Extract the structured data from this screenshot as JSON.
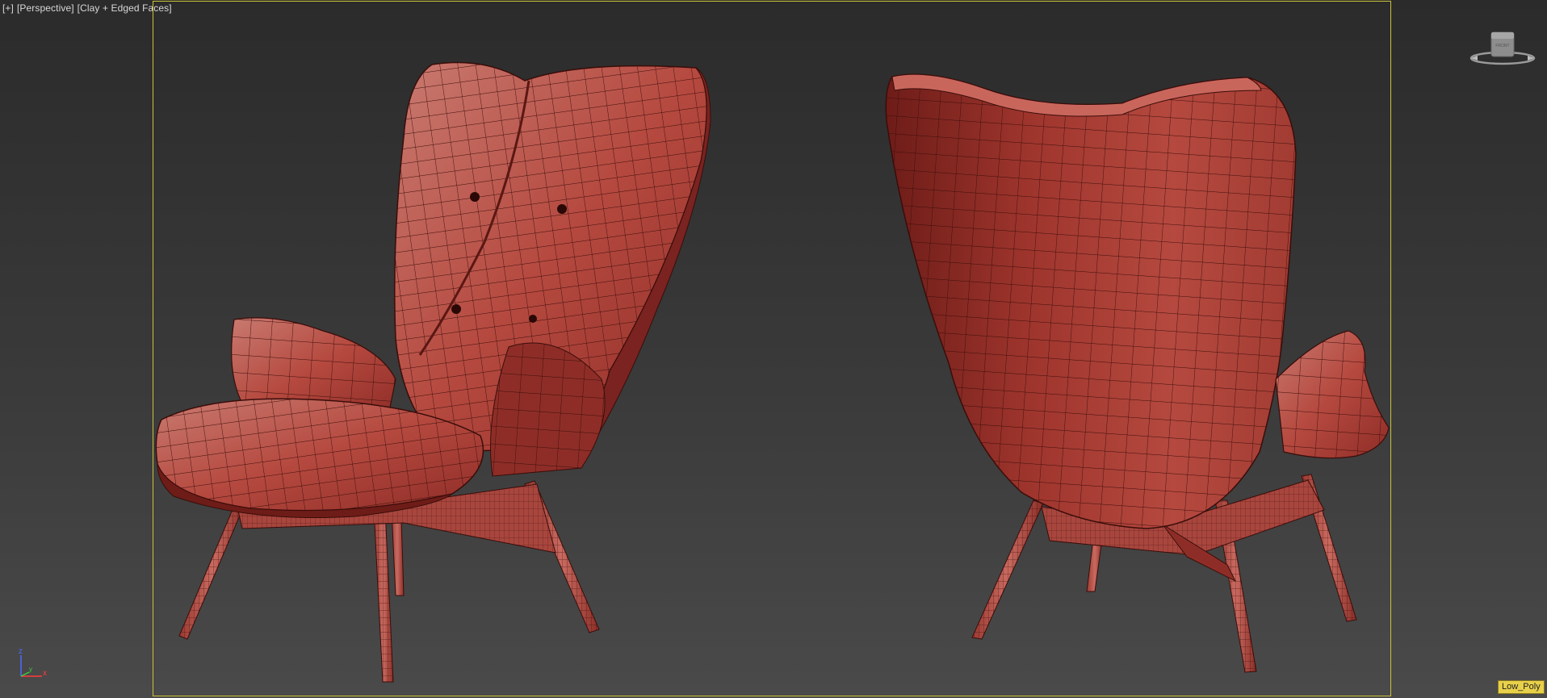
{
  "viewport": {
    "label_plus": "[+]",
    "label_view": "[Perspective]",
    "label_shading": "[Clay + Edged Faces]"
  },
  "viewcube": {
    "face_label": "FRONT"
  },
  "axis": {
    "x": "x",
    "y": "y",
    "z": "z"
  },
  "badge": {
    "text": "Low_Poly"
  },
  "colors": {
    "frame": "#c9c23a",
    "clay": "#b5493f",
    "clay_dark": "#7a2320",
    "clay_light": "#c96a60",
    "wire": "#3a0d0a",
    "badge_bg": "#e8d04a"
  }
}
